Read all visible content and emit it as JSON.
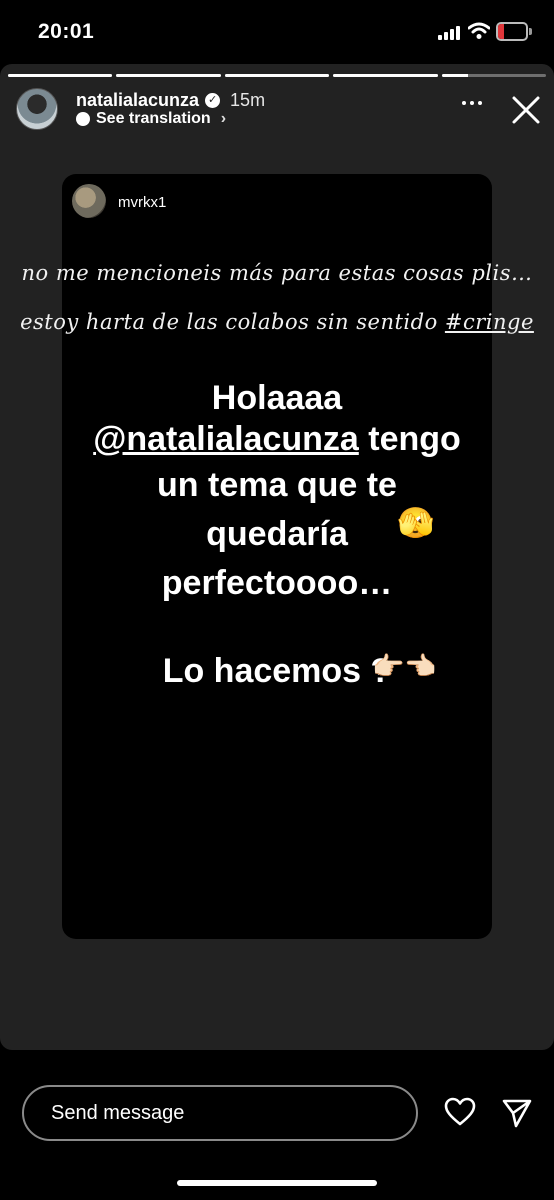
{
  "status_bar": {
    "time": "20:01",
    "battery_level": "10",
    "battery_color": "#e0363a"
  },
  "story": {
    "progress_segments": [
      1,
      1,
      1,
      1,
      0.25
    ],
    "username": "natalialacunza",
    "verified_icon": "verified-badge-icon",
    "time_ago": "15m",
    "see_translation": "See translation",
    "more_icon": "more-options-icon",
    "close_icon": "close-icon"
  },
  "reshared_post": {
    "username": "mvrkx1",
    "caption_line1": "no me mencioneis más para estas cosas plis…",
    "caption_line2_text": "estoy harta de las colabos sin sentido ",
    "caption_hashtag": "#cringe",
    "message_line1": "Holaaaa",
    "message_mention": "@natalialacunza",
    "message_line2_rest": " tengo",
    "message_line3": "un tema que te",
    "message_line4": "quedaría",
    "message_line5": "perfectoooo…",
    "message_line6": "Lo hacemos ?",
    "emoji_face": "🫣",
    "emoji_hands": "👉🏻👈🏻"
  },
  "footer": {
    "message_placeholder": "Send message",
    "like_icon": "heart-icon",
    "send_icon": "send-icon"
  }
}
